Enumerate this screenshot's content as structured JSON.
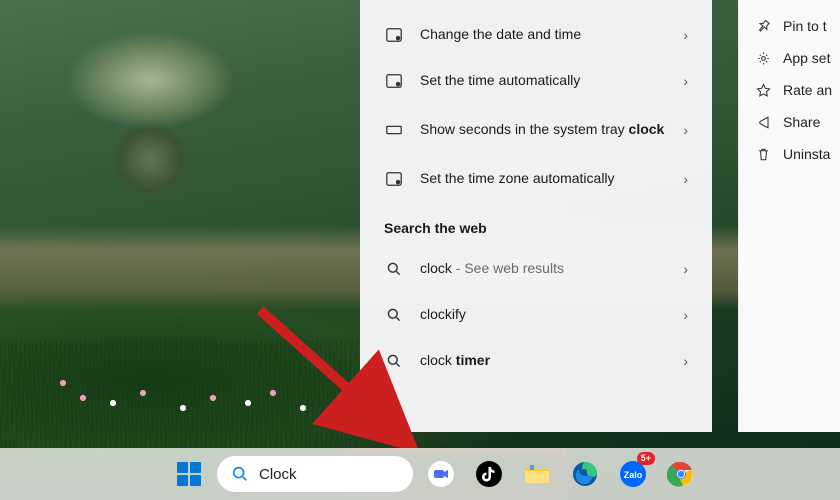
{
  "results": {
    "settings": [
      {
        "label": "Change the date and time",
        "bold": ""
      },
      {
        "label": "Set the time automatically",
        "bold": ""
      },
      {
        "label": "Show seconds in the system tray ",
        "bold": "clock"
      },
      {
        "label": "Set the time zone automatically",
        "bold": ""
      }
    ],
    "web_header": "Search the web",
    "web": [
      {
        "label": "clock",
        "hint": " - See web results"
      },
      {
        "label": "clockify",
        "hint": ""
      },
      {
        "label_pre": "clock ",
        "bold": "timer"
      }
    ]
  },
  "context_menu": [
    "Pin to t",
    "App set",
    "Rate an",
    "Share",
    "Uninsta"
  ],
  "search": {
    "value": "Clock"
  },
  "badge": "5+"
}
